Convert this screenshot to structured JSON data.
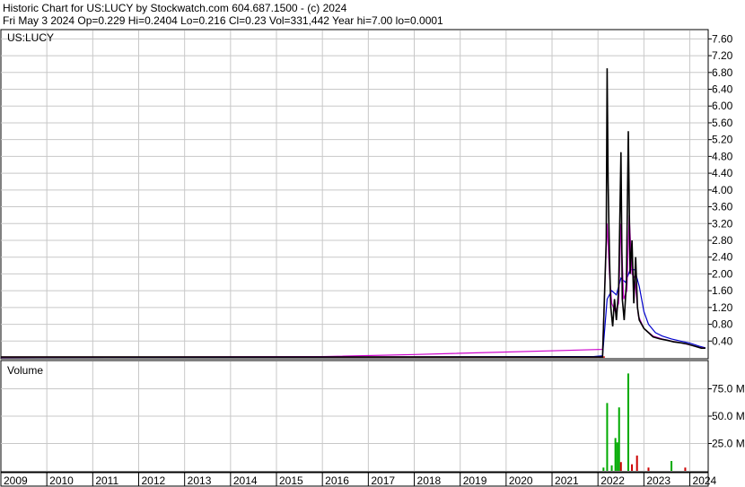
{
  "header": {
    "line1": "Historic Chart for US:LUCY by Stockwatch.com 604.687.1500 - (c) 2024",
    "line2": "Fri May  3 2024   Op=0.229   Hi=0.2404   Lo=0.216   Cl=0.23   Vol=331,442   Year hi=7.00   lo=0.0001"
  },
  "colors": {
    "price": "#000000",
    "ma_fast": "#cc00cc",
    "ma_slow": "#0000cc",
    "grid": "#c8c8c8",
    "volume_up": "#00aa00",
    "volume_down": "#cc0000",
    "price_baseline": "#cc0000"
  },
  "chart_data": [
    {
      "type": "line",
      "title": "US:LUCY",
      "x_ticks": [
        "2009",
        "2010",
        "2011",
        "2012",
        "2013",
        "2014",
        "2015",
        "2016",
        "2017",
        "2018",
        "2019",
        "2020",
        "2021",
        "2022",
        "2023",
        "2024"
      ],
      "y_ticks": [
        "7.60",
        "7.20",
        "6.80",
        "6.40",
        "6.00",
        "5.60",
        "5.20",
        "4.80",
        "4.40",
        "4.00",
        "3.60",
        "3.20",
        "2.80",
        "2.40",
        "2.00",
        "1.60",
        "1.20",
        "0.80",
        "0.40"
      ],
      "ylim": [
        0,
        7.8
      ],
      "grid": true,
      "series": [
        {
          "role": "price",
          "points": [
            [
              2009.0,
              0.02
            ],
            [
              2016.0,
              0.02
            ],
            [
              2022.0,
              0.02
            ],
            [
              2022.1,
              0.02
            ],
            [
              2022.18,
              2.8
            ],
            [
              2022.2,
              6.9
            ],
            [
              2022.22,
              4.2
            ],
            [
              2022.25,
              2.4
            ],
            [
              2022.28,
              1.2
            ],
            [
              2022.32,
              0.75
            ],
            [
              2022.36,
              1.4
            ],
            [
              2022.4,
              0.9
            ],
            [
              2022.45,
              1.6
            ],
            [
              2022.5,
              4.9
            ],
            [
              2022.53,
              1.4
            ],
            [
              2022.57,
              0.9
            ],
            [
              2022.62,
              1.8
            ],
            [
              2022.66,
              5.4
            ],
            [
              2022.7,
              2.0
            ],
            [
              2022.74,
              2.8
            ],
            [
              2022.78,
              1.3
            ],
            [
              2022.82,
              2.4
            ],
            [
              2022.86,
              1.2
            ],
            [
              2022.9,
              0.9
            ],
            [
              2023.0,
              0.7
            ],
            [
              2023.1,
              0.6
            ],
            [
              2023.2,
              0.5
            ],
            [
              2023.35,
              0.45
            ],
            [
              2023.5,
              0.42
            ],
            [
              2023.65,
              0.38
            ],
            [
              2023.8,
              0.36
            ],
            [
              2023.95,
              0.33
            ],
            [
              2024.1,
              0.28
            ],
            [
              2024.25,
              0.23
            ],
            [
              2024.34,
              0.23
            ]
          ]
        },
        {
          "role": "ma_fast",
          "points": [
            [
              2009.0,
              0.01
            ],
            [
              2016.0,
              0.03
            ],
            [
              2018.0,
              0.08
            ],
            [
              2022.1,
              0.2
            ],
            [
              2022.2,
              3.2
            ],
            [
              2022.25,
              2.0
            ],
            [
              2022.3,
              1.3
            ],
            [
              2022.38,
              1.1
            ],
            [
              2022.45,
              1.3
            ],
            [
              2022.5,
              3.2
            ],
            [
              2022.56,
              1.4
            ],
            [
              2022.63,
              1.6
            ],
            [
              2022.68,
              3.4
            ],
            [
              2022.74,
              2.0
            ],
            [
              2022.8,
              1.9
            ],
            [
              2022.88,
              1.0
            ],
            [
              2023.0,
              0.7
            ],
            [
              2023.2,
              0.52
            ],
            [
              2023.4,
              0.45
            ],
            [
              2023.6,
              0.4
            ],
            [
              2023.8,
              0.36
            ],
            [
              2024.0,
              0.31
            ],
            [
              2024.2,
              0.25
            ],
            [
              2024.34,
              0.23
            ]
          ]
        },
        {
          "role": "ma_slow",
          "points": [
            [
              2009.0,
              0.01
            ],
            [
              2016.0,
              0.02
            ],
            [
              2021.9,
              0.03
            ],
            [
              2022.1,
              0.05
            ],
            [
              2022.2,
              1.4
            ],
            [
              2022.3,
              1.6
            ],
            [
              2022.4,
              1.5
            ],
            [
              2022.5,
              1.9
            ],
            [
              2022.6,
              1.8
            ],
            [
              2022.7,
              2.1
            ],
            [
              2022.8,
              2.1
            ],
            [
              2022.9,
              1.7
            ],
            [
              2023.0,
              1.1
            ],
            [
              2023.1,
              0.8
            ],
            [
              2023.25,
              0.6
            ],
            [
              2023.4,
              0.52
            ],
            [
              2023.6,
              0.45
            ],
            [
              2023.8,
              0.4
            ],
            [
              2024.0,
              0.35
            ],
            [
              2024.2,
              0.28
            ],
            [
              2024.34,
              0.24
            ]
          ]
        }
      ]
    },
    {
      "type": "bar",
      "title": "Volume",
      "y_ticks": [
        "75.0 M",
        "50.0 M",
        "25.0 M"
      ],
      "ylim": [
        0,
        100
      ],
      "bars": [
        [
          2022.12,
          3,
          "up"
        ],
        [
          2022.2,
          62,
          "up"
        ],
        [
          2022.3,
          5,
          "up"
        ],
        [
          2022.38,
          30,
          "up"
        ],
        [
          2022.42,
          26,
          "up"
        ],
        [
          2022.46,
          58,
          "up"
        ],
        [
          2022.5,
          8,
          "down"
        ],
        [
          2022.66,
          89,
          "up"
        ],
        [
          2022.74,
          6,
          "down"
        ],
        [
          2022.85,
          14,
          "down"
        ],
        [
          2023.1,
          3,
          "down"
        ],
        [
          2023.6,
          9,
          "up"
        ],
        [
          2023.9,
          3,
          "down"
        ]
      ]
    }
  ]
}
